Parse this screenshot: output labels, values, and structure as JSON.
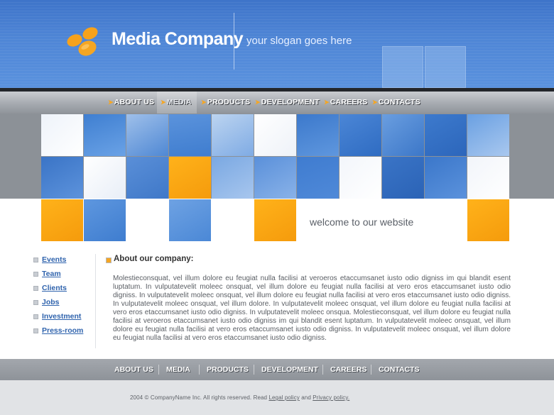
{
  "brand": {
    "title": "Media Company",
    "slogan": "your slogan goes here",
    "logo_icon": "orange-circles-logo-icon",
    "colors": {
      "header_blue": "#4f86d6",
      "accent_orange": "#f5a623",
      "link_blue": "#2f63ad"
    }
  },
  "topnav": {
    "items": [
      "ABOUT US",
      "MEDIA",
      "PRODUCTS",
      "DEVELOPMENT",
      "CAREERS",
      "CONTACTS"
    ],
    "active": "MEDIA"
  },
  "banner": {
    "welcome": "welcome to our website"
  },
  "sidebar": {
    "items": [
      "Events",
      "Team",
      "Clients",
      "Jobs",
      "Investment",
      "Press-room"
    ]
  },
  "content": {
    "title": "About our company:",
    "body": "Molestieconsquat, vel illum dolore eu feugiat nulla facilisi at veroeros etaccumsanet iusto odio digniss im qui blandit esent luptatum. In vulputatevelit moleec onsquat, vel illum dolore eu feugiat nulla facilisi at vero eros etaccumsanet iusto odio digniss. In vulputatevelit moleec onsquat, vel illum dolore eu feugiat nulla facilisi at vero eros etaccumsanet iusto odio digniss. In vulputatevelit moleec onsquat, vel illum dolore. In vulputatevelit moleec onsquat, vel illum dolore eu feugiat nulla facilisi at vero eros etaccumsanet iusto odio digniss. In vulputatevelit moleec onsqua. Molestieconsquat, vel illum dolore eu feugiat nulla facilisi at veroeros etaccumsanet iusto odio digniss im qui blandit esent luptatum. In vulputatevelit moleec onsquat, vel illum dolore eu feugiat nulla facilisi at vero eros etaccumsanet iusto odio digniss. In vulputatevelit moleec onsquat, vel illum dolore eu feugiat nulla facilisi at vero eros etaccumsanet iusto odio digniss."
  },
  "bottomnav": {
    "items": [
      "ABOUT US",
      "MEDIA",
      "PRODUCTS",
      "DEVELOPMENT",
      "CAREERS",
      "CONTACTS"
    ]
  },
  "footer": {
    "copyright": "2004 © CompanyName Inc. All rights reserved. Read",
    "legal_link": "Legal policy",
    "and": "and",
    "privacy_link": "Privacy policy."
  }
}
